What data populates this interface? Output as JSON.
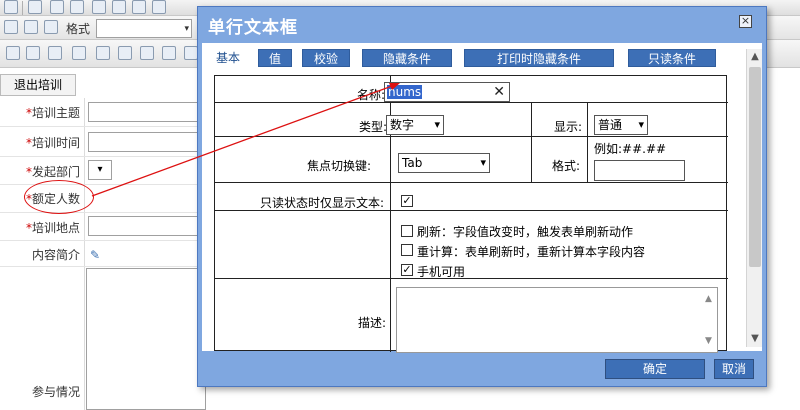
{
  "background": {
    "toolbar_format_label": "格式",
    "exit_button": "退出培训",
    "fields": [
      {
        "label": "培训主题",
        "required": true
      },
      {
        "label": "培训时间",
        "required": true
      },
      {
        "label": "发起部门",
        "required": true
      },
      {
        "label": "额定人数",
        "required": true
      },
      {
        "label": "培训地点",
        "required": true
      },
      {
        "label": "内容简介",
        "required": false
      },
      {
        "label": "参与情况",
        "required": false
      }
    ],
    "required_marker": "*"
  },
  "dialog": {
    "title": "单行文本框",
    "close_icon": "×",
    "tabs": [
      {
        "label": "基本",
        "active": true
      },
      {
        "label": "值",
        "active": false
      },
      {
        "label": "校验",
        "active": false
      },
      {
        "label": "隐藏条件",
        "active": false
      },
      {
        "label": "打印时隐藏条件",
        "active": false
      },
      {
        "label": "只读条件",
        "active": false
      }
    ],
    "form": {
      "name_label": "名称:",
      "name_value": "nums",
      "clear_icon": "✕",
      "type_label": "类型:",
      "type_value": "数字",
      "display_label": "显示:",
      "display_value": "普通",
      "focus_label": "焦点切换键:",
      "focus_value": "Tab",
      "format_label": "格式:",
      "format_hint": "例如:##.##",
      "readonly_text_label": "只读状态时仅显示文本:",
      "readonly_text_checked": true,
      "options": [
        {
          "label": "刷新：字段值改变时，触发表单刷新动作",
          "checked": false
        },
        {
          "label": "重计算：表单刷新时，重新计算本字段内容",
          "checked": false
        },
        {
          "label": "手机可用",
          "checked": true
        }
      ],
      "desc_label": "描述:"
    },
    "buttons": {
      "ok": "确定",
      "cancel": "取消"
    },
    "check_glyph": "✓",
    "chevron_glyph": "▾"
  }
}
